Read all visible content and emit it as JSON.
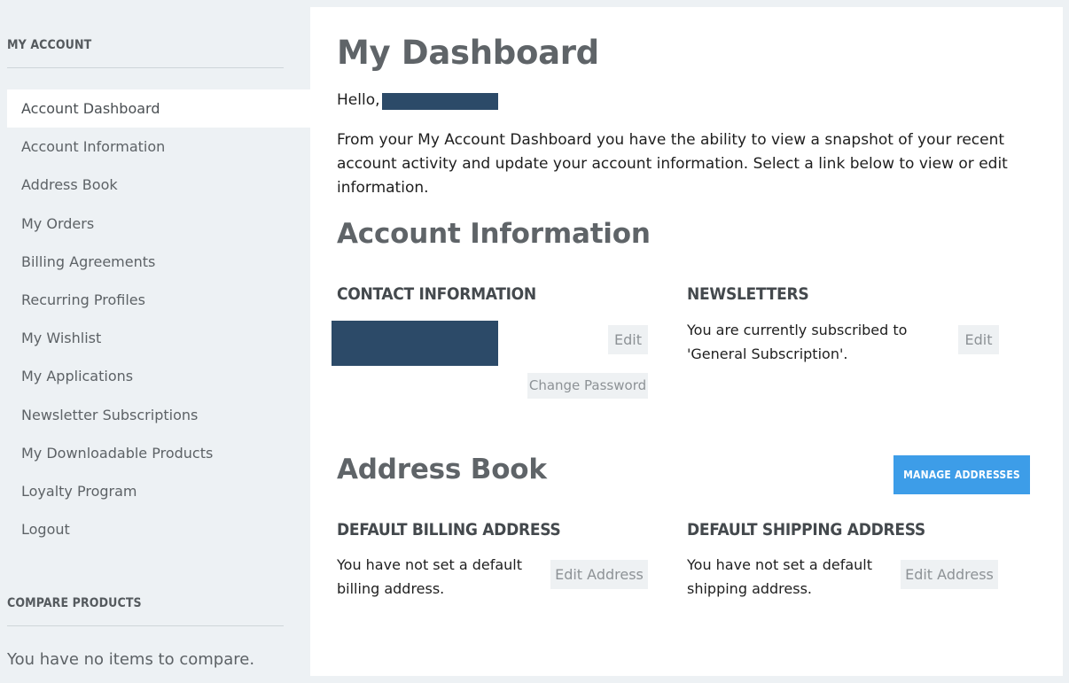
{
  "sidebar": {
    "account_title": "MY ACCOUNT",
    "items": [
      {
        "label": "Account Dashboard",
        "active": true
      },
      {
        "label": "Account Information"
      },
      {
        "label": "Address Book"
      },
      {
        "label": "My Orders"
      },
      {
        "label": "Billing Agreements"
      },
      {
        "label": "Recurring Profiles"
      },
      {
        "label": "My Wishlist"
      },
      {
        "label": "My Applications"
      },
      {
        "label": "Newsletter Subscriptions"
      },
      {
        "label": "My Downloadable Products"
      },
      {
        "label": "Loyalty Program"
      },
      {
        "label": "Logout"
      }
    ],
    "compare_title": "COMPARE PRODUCTS",
    "compare_empty": "You have no items to compare."
  },
  "main": {
    "title": "My Dashboard",
    "hello": "Hello,",
    "intro": "From your My Account Dashboard you have the ability to view a snapshot of your recent account activity and update your account information. Select a link below to view or edit information.",
    "account_info": {
      "title": "Account Information",
      "contact_title": "CONTACT INFORMATION",
      "edit_label": "Edit",
      "change_password_label": "Change Password",
      "newsletters_title": "NEWSLETTERS",
      "newsletters_text": "You are currently subscribed to 'General Subscription'.",
      "newsletters_edit_label": "Edit"
    },
    "address_book": {
      "title": "Address Book",
      "manage_label": "MANAGE ADDRESSES",
      "billing_title": "DEFAULT BILLING ADDRESS",
      "billing_text": "You have not set a default billing address.",
      "shipping_title": "DEFAULT SHIPPING ADDRESS",
      "shipping_text": "You have not set a default shipping address.",
      "edit_address_label": "Edit Address"
    }
  },
  "colors": {
    "background": "#edf1f4",
    "accent": "#3d9de8",
    "redaction": "#2c4a68"
  }
}
